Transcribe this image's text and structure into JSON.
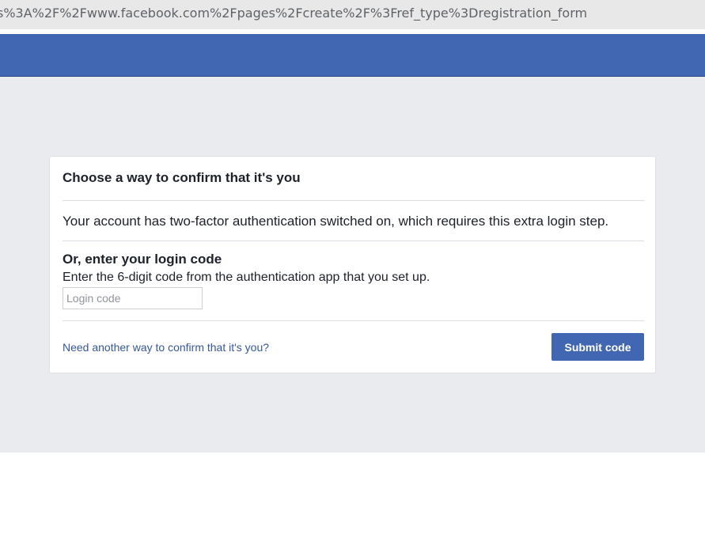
{
  "browser": {
    "url": "s%3A%2F%2Fwww.facebook.com%2Fpages%2Fcreate%2F%3Fref_type%3Dregistration_form"
  },
  "colors": {
    "header_bg": "#4267b2",
    "content_bg": "#e9ebee",
    "button_bg": "#4267b2",
    "link": "#365899"
  },
  "dialog": {
    "title": "Choose a way to confirm that it's you",
    "info": "Your account has two-factor authentication switched on, which requires this extra login step.",
    "code_section": {
      "heading": "Or, enter your login code",
      "description": "Enter the 6-digit code from the authentication app that you set up.",
      "input_placeholder": "Login code",
      "input_value": ""
    },
    "footer": {
      "alt_link": "Need another way to confirm that it's you?",
      "submit_label": "Submit code"
    }
  }
}
